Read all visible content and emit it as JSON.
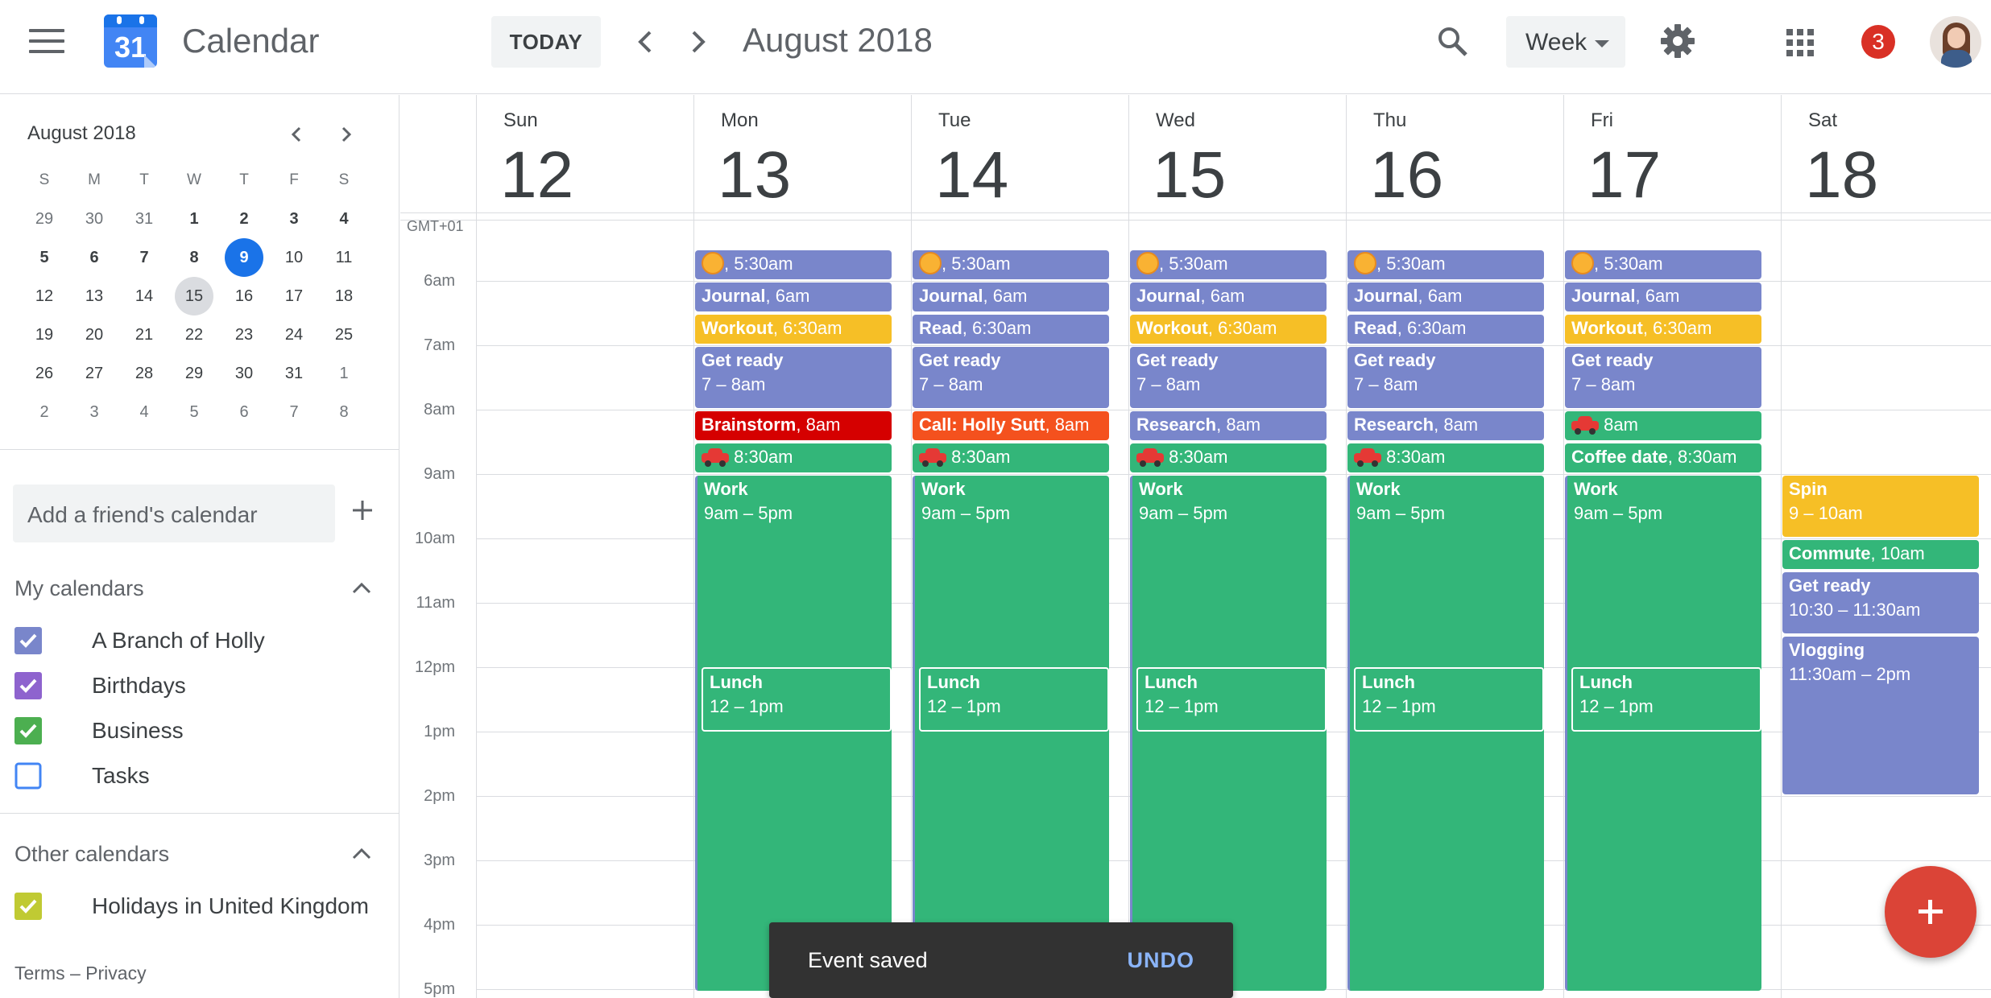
{
  "app": {
    "title": "Calendar",
    "logo_day": "31"
  },
  "header": {
    "today_label": "TODAY",
    "month_title": "August 2018",
    "view": "Week",
    "notifications": "3"
  },
  "mini_calendar": {
    "title": "August 2018",
    "dow": [
      "S",
      "M",
      "T",
      "W",
      "T",
      "F",
      "S"
    ],
    "weeks": [
      [
        "29",
        "30",
        "31",
        "1",
        "2",
        "3",
        "4"
      ],
      [
        "5",
        "6",
        "7",
        "8",
        "9",
        "10",
        "11"
      ],
      [
        "12",
        "13",
        "14",
        "15",
        "16",
        "17",
        "18"
      ],
      [
        "19",
        "20",
        "21",
        "22",
        "23",
        "24",
        "25"
      ],
      [
        "26",
        "27",
        "28",
        "29",
        "30",
        "31",
        "1"
      ],
      [
        "2",
        "3",
        "4",
        "5",
        "6",
        "7",
        "8"
      ]
    ],
    "today": "9",
    "selected": "15"
  },
  "sidebar": {
    "friend_placeholder": "Add a friend's calendar",
    "my_calendars_title": "My calendars",
    "my_calendars": [
      {
        "name": "A Branch of Holly",
        "color": "#7986cb",
        "checked": true
      },
      {
        "name": "Birthdays",
        "color": "#8e63ce",
        "checked": true
      },
      {
        "name": "Business",
        "color": "#4caf50",
        "checked": true
      },
      {
        "name": "Tasks",
        "color": "#4285f4",
        "checked": false
      }
    ],
    "other_calendars_title": "Other calendars",
    "other_calendars": [
      {
        "name": "Holidays in United Kingdom",
        "color": "#c0ca33",
        "checked": true
      }
    ],
    "footer": "Terms – Privacy"
  },
  "week": {
    "timezone": "GMT+01",
    "days": [
      {
        "name": "Sun",
        "num": "12"
      },
      {
        "name": "Mon",
        "num": "13"
      },
      {
        "name": "Tue",
        "num": "14"
      },
      {
        "name": "Wed",
        "num": "15"
      },
      {
        "name": "Thu",
        "num": "16"
      },
      {
        "name": "Fri",
        "num": "17"
      },
      {
        "name": "Sat",
        "num": "18"
      }
    ],
    "hours": [
      "6am",
      "7am",
      "8am",
      "9am",
      "10am",
      "11am",
      "12pm",
      "1pm",
      "2pm",
      "3pm",
      "4pm",
      "5pm"
    ]
  },
  "events": {
    "sun_time": "5:30am",
    "journal": {
      "title": "Journal",
      "time": "6am"
    },
    "workout": {
      "title": "Workout",
      "time": "6:30am"
    },
    "read": {
      "title": "Read",
      "time": "6:30am"
    },
    "get_ready": {
      "title": "Get ready",
      "time": "7 – 8am"
    },
    "brainstorm": {
      "title": "Brainstorm",
      "time": "8am"
    },
    "call": {
      "title": "Call: Holly Sutt",
      "time": "8am"
    },
    "research": {
      "title": "Research",
      "time": "8am"
    },
    "car_8": "8am",
    "car_830": "8:30am",
    "coffee": {
      "title": "Coffee date",
      "time": "8:30am"
    },
    "work": {
      "title": "Work",
      "time": "9am – 5pm"
    },
    "lunch": {
      "title": "Lunch",
      "time": "12 – 1pm"
    },
    "spin": {
      "title": "Spin",
      "time": "9 – 10am"
    },
    "commute": {
      "title": "Commute",
      "time": "10am"
    },
    "get_ready_sat": {
      "title": "Get ready",
      "time": "10:30 – 11:30am"
    },
    "vlogging": {
      "title": "Vlogging",
      "time": "11:30am – 2pm"
    }
  },
  "snackbar": {
    "message": "Event saved",
    "action": "UNDO"
  }
}
